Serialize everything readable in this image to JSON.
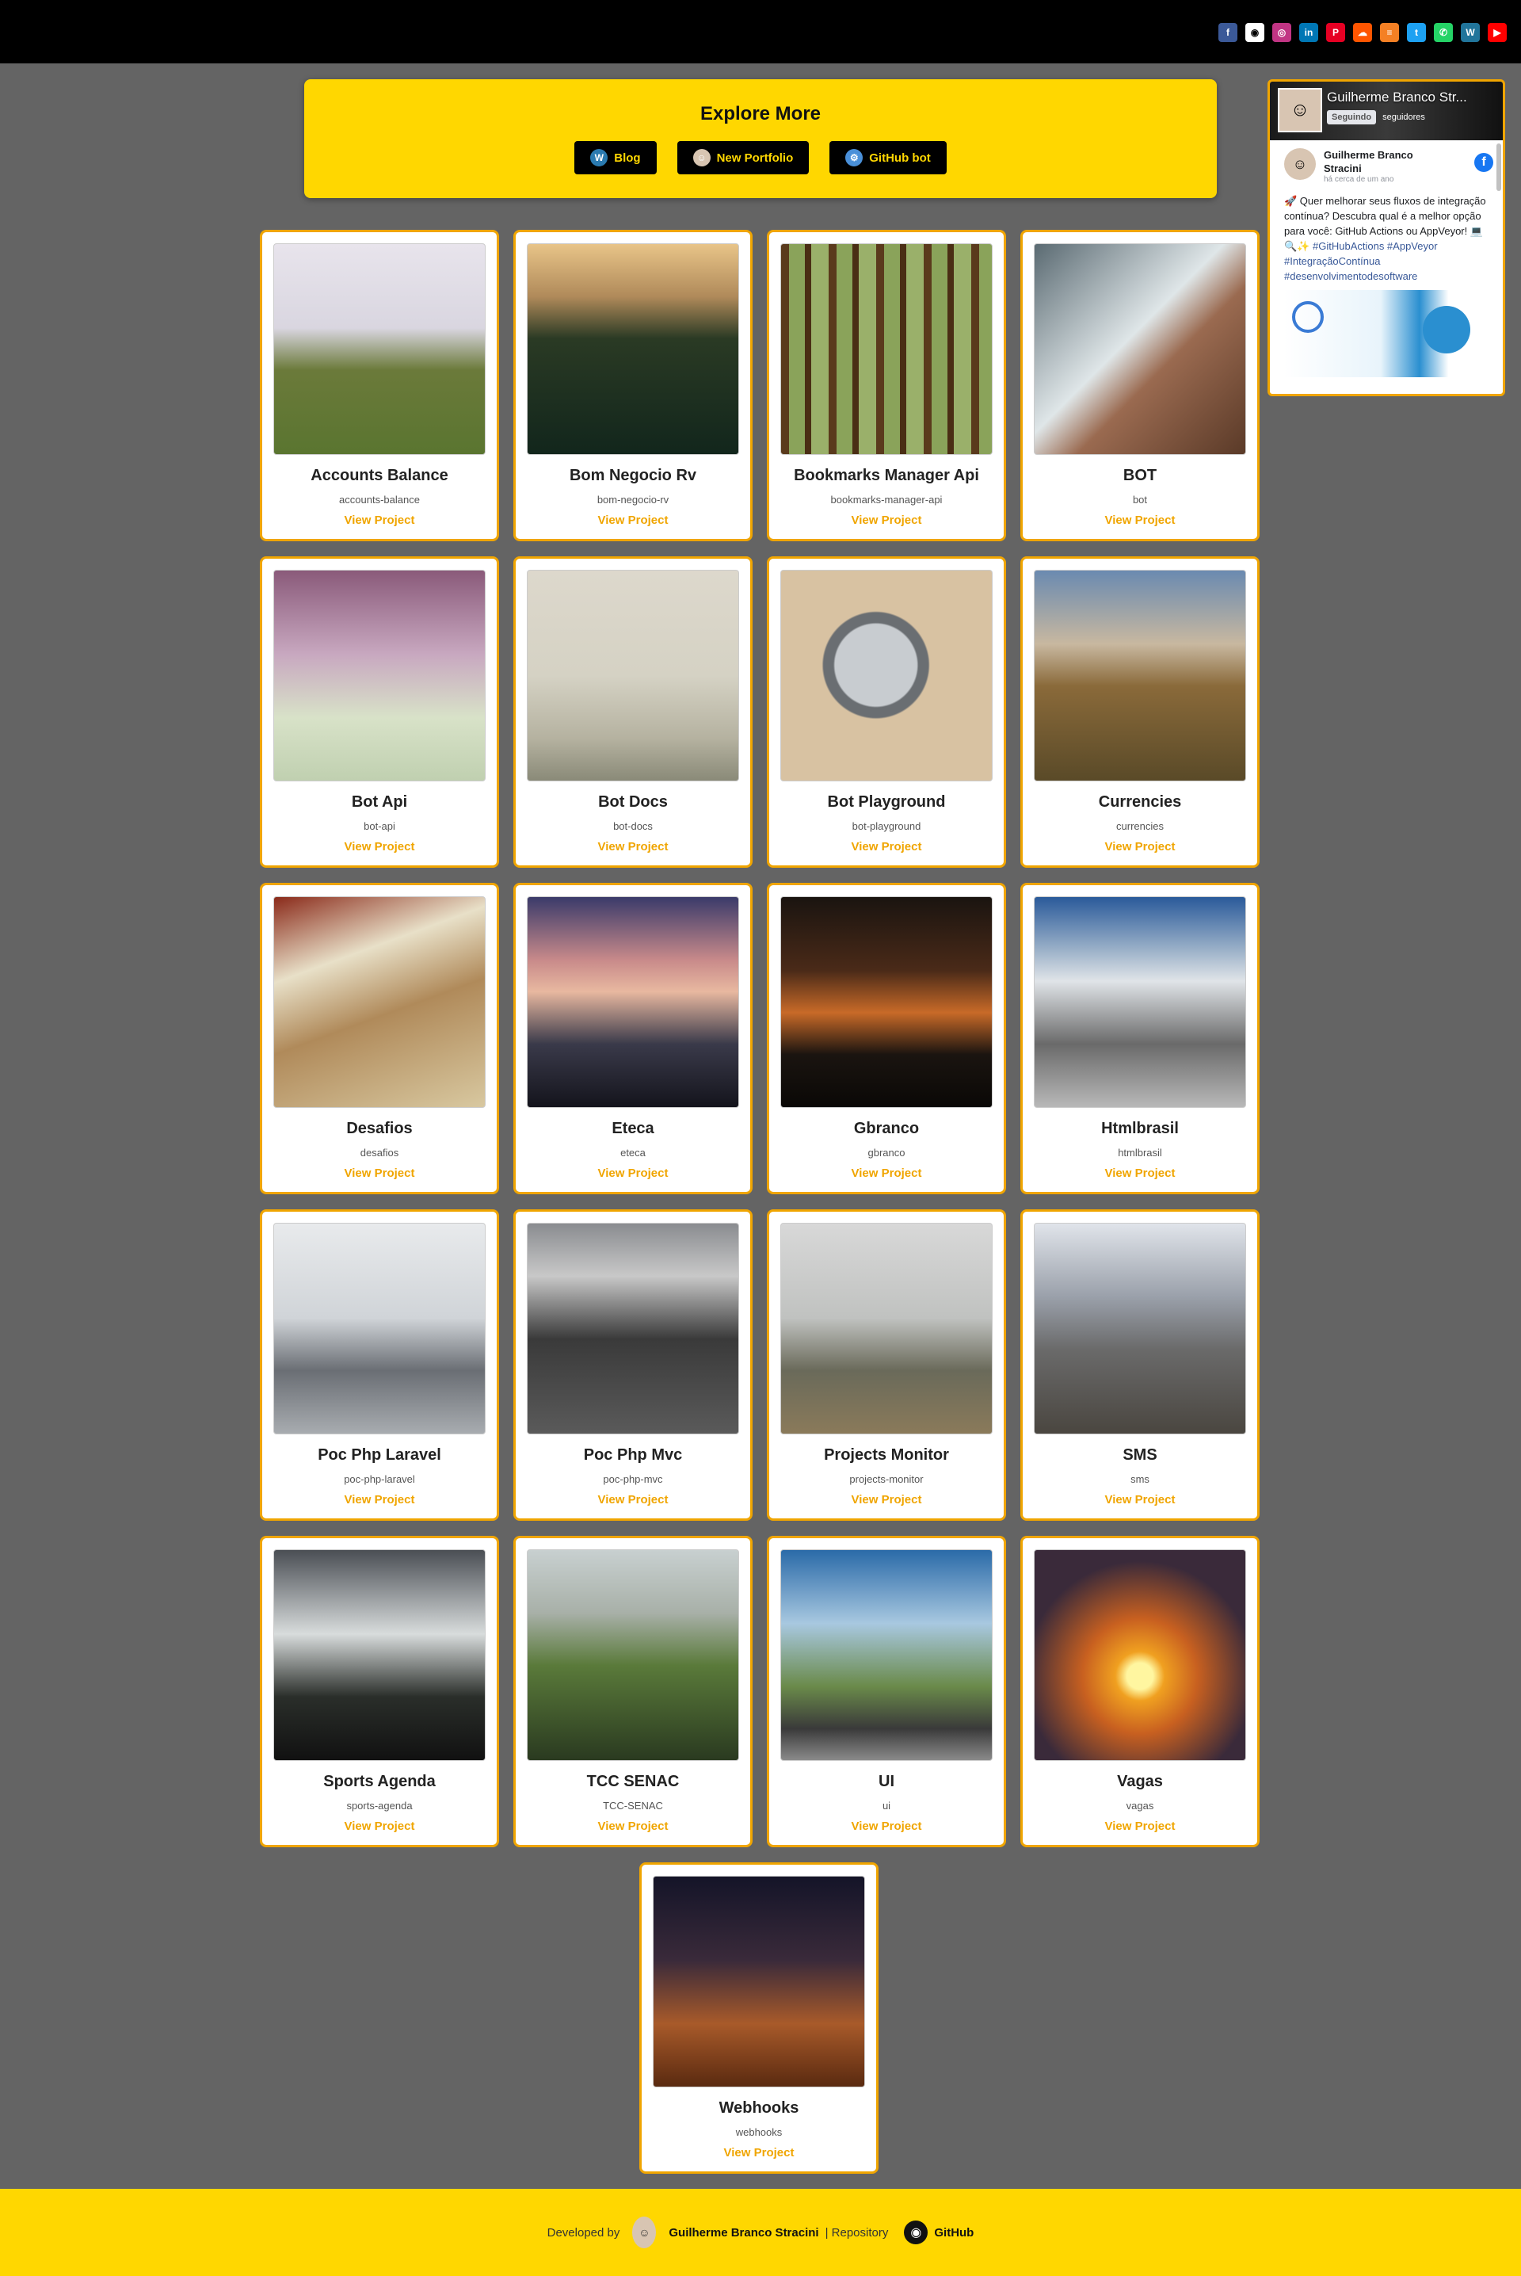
{
  "social_icons": [
    {
      "name": "facebook-icon",
      "glyph": "f",
      "color": "#3b5998"
    },
    {
      "name": "github-icon",
      "glyph": "◉",
      "color": "#ffffff"
    },
    {
      "name": "instagram-icon",
      "glyph": "◎",
      "color": "#c13584"
    },
    {
      "name": "linkedin-icon",
      "glyph": "in",
      "color": "#0077b5"
    },
    {
      "name": "pinterest-icon",
      "glyph": "P",
      "color": "#e60023"
    },
    {
      "name": "soundcloud-icon",
      "glyph": "☁",
      "color": "#ff5500"
    },
    {
      "name": "stackoverflow-icon",
      "glyph": "≡",
      "color": "#f48024"
    },
    {
      "name": "twitter-icon",
      "glyph": "t",
      "color": "#1da1f2"
    },
    {
      "name": "whatsapp-icon",
      "glyph": "✆",
      "color": "#25d366"
    },
    {
      "name": "wordpress-icon",
      "glyph": "W",
      "color": "#21759b"
    },
    {
      "name": "youtube-icon",
      "glyph": "▶",
      "color": "#ff0000"
    }
  ],
  "explore": {
    "title": "Explore More",
    "links": [
      {
        "name": "blog-link",
        "label": "Blog",
        "icon": "wordpress-icon",
        "glyph": "W",
        "icon_bg": "#2a7ab0"
      },
      {
        "name": "new-portfolio-link",
        "label": "New Portfolio",
        "icon": "avatar-icon",
        "glyph": "☺",
        "icon_bg": "#d8c5b2"
      },
      {
        "name": "github-bot-link",
        "label": "GitHub bot",
        "icon": "bot-icon",
        "glyph": "⚙",
        "icon_bg": "#4a90d9"
      }
    ]
  },
  "facebook": {
    "page_name": "Guilherme Branco Str...",
    "follow_label": "Seguindo",
    "followers": "seguidores",
    "post_author": "Guilherme Branco Stracini",
    "post_time": "há cerca de um ano",
    "post_text": "🚀 Quer melhorar seus fluxos de integração contínua? Descubra qual é a melhor opção para você: GitHub Actions ou AppVeyor! 💻🔍✨",
    "post_tags": "#GitHubActions #AppVeyor #IntegraçãoContínua #desenvolvimentodesoftware"
  },
  "projects": [
    {
      "title": "Accounts Balance",
      "slug": "accounts-balance",
      "bg": "linear-gradient(180deg,#e8e4ec 0%,#d9d6e0 40%,#6b7a3a 60%,#5a7530 100%)"
    },
    {
      "title": "Bom Negocio Rv",
      "slug": "bom-negocio-rv",
      "bg": "linear-gradient(180deg,#e8c488 0%,#b08a5a 25%,#2a3a24 45%,#12261c 100%)"
    },
    {
      "title": "Bookmarks Manager Api",
      "slug": "bookmarks-manager-api",
      "bg": "repeating-linear-gradient(90deg,#5a3a1c 0 10px,#8aa35a 10px 30px,#4a2e14 30px 38px,#9ab06a 38px 60px)"
    },
    {
      "title": "BOT",
      "slug": "bot",
      "bg": "linear-gradient(135deg,#5a6a72 0%,#dfe6e8 45%,#9a6a50 60%,#5a3a28 100%)"
    },
    {
      "title": "Bot Api",
      "slug": "bot-api",
      "bg": "linear-gradient(180deg,#8a5a7a 0%,#c8a8c0 40%,#d8e2c8 70%,#c0d0b0 100%)"
    },
    {
      "title": "Bot Docs",
      "slug": "bot-docs",
      "bg": "linear-gradient(180deg,#ddd8cc 0%,#d5d2c4 50%,#b5b2a0 80%,#8a8a78 100%)"
    },
    {
      "title": "Bot Playground",
      "slug": "bot-playground",
      "bg": "radial-gradient(circle at 45% 45%,#c8ccd0 0 25%,#6a6e72 26% 32%,#d8c2a2 33%)"
    },
    {
      "title": "Currencies",
      "slug": "currencies",
      "bg": "linear-gradient(180deg,#6a8ab0 0%,#c8b8a0 35%,#8a6a3a 55%,#5a4a28 100%)"
    },
    {
      "title": "Desafios",
      "slug": "desafios",
      "bg": "linear-gradient(160deg,#8a2a1a 0%,#e8e0c8 30%,#b08a5a 55%,#d8c8a0 100%)"
    },
    {
      "title": "Eteca",
      "slug": "eteca",
      "bg": "linear-gradient(180deg,#3a3a6a 0%,#c88a8a 30%,#e8b8a0 45%,#3a3a4a 70%,#14141c 100%)"
    },
    {
      "title": "Gbranco",
      "slug": "gbranco",
      "bg": "linear-gradient(180deg,#1a1410 0%,#4a2a18 35%,#c86a28 55%,#1a1410 75%,#0a0806 100%)"
    },
    {
      "title": "Htmlbrasil",
      "slug": "htmlbrasil",
      "bg": "linear-gradient(180deg,#2a5a9a 0%,#9ab0c8 25%,#e0e4e8 40%,#6a6a6a 70%,#b8b8b8 100%)"
    },
    {
      "title": "Poc Php Laravel",
      "slug": "poc-php-laravel",
      "bg": "linear-gradient(180deg,#e8eaec 0%,#d0d4d8 45%,#6a6e74 70%,#a8acb0 100%)"
    },
    {
      "title": "Poc Php Mvc",
      "slug": "poc-php-mvc",
      "bg": "linear-gradient(180deg,#8a8c90 0%,#c8c8c8 25%,#3a3a3a 55%,#5a5a5a 100%)"
    },
    {
      "title": "Projects Monitor",
      "slug": "projects-monitor",
      "bg": "linear-gradient(180deg,#d8d8d8 0%,#c0c2c0 45%,#6a6a5a 70%,#8a7a5a 100%)"
    },
    {
      "title": "SMS",
      "slug": "sms",
      "bg": "linear-gradient(180deg,#e0e4ea 0%,#9aa0aa 35%,#6a6a6a 60%,#4a4640 100%)"
    },
    {
      "title": "Sports Agenda",
      "slug": "sports-agenda",
      "bg": "linear-gradient(180deg,#4a4e54 0%,#d8dcdc 40%,#2a2e2a 70%,#111 100%)"
    },
    {
      "title": "TCC SENAC",
      "slug": "TCC-SENAC",
      "bg": "linear-gradient(180deg,#c8d0d0 0%,#a8b0a8 30%,#5a7a3a 55%,#2a3a20 100%)"
    },
    {
      "title": "UI",
      "slug": "ui",
      "bg": "linear-gradient(180deg,#2a6aa8 0%,#a8c8e0 35%,#6a8a4a 65%,#3a3a3a 85%,#8a8a8a 100%)"
    },
    {
      "title": "Vagas",
      "slug": "vagas",
      "bg": "radial-gradient(circle at 50% 60%,#fff6a0 0 8%,#f0a020 15%,#c86020 35%,#3a2a3a 70%)"
    },
    {
      "title": "Webhooks",
      "slug": "webhooks",
      "bg": "linear-gradient(180deg,#141428 0%,#3a2a3a 40%,#a85a2a 70%,#5a2a10 100%)"
    }
  ],
  "view_label": "View Project",
  "footer": {
    "developed_by": "Developed by",
    "author": "Guilherme Branco Stracini",
    "repository": "| Repository",
    "github": "GitHub"
  }
}
